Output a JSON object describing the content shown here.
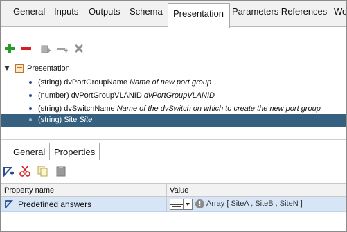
{
  "top_tabs": [
    {
      "label": "General"
    },
    {
      "label": "Inputs"
    },
    {
      "label": "Outputs"
    },
    {
      "label": "Schema"
    },
    {
      "label": "Presentation"
    },
    {
      "label": "Parameters References"
    },
    {
      "label": "Wo"
    }
  ],
  "active_top_tab": "Presentation",
  "toolbar": {
    "icons": [
      "add-icon",
      "remove-icon",
      "add-group-icon",
      "add-step-icon",
      "delete-icon"
    ],
    "colors": {
      "add": "#2a9a2a",
      "remove": "#d42020",
      "disabled": "#9a9a9a"
    }
  },
  "tree": {
    "root_label": "Presentation",
    "items": [
      {
        "type": "(string)",
        "name": "dvPortGroupName",
        "description": "Name of new port group"
      },
      {
        "type": "(number)",
        "name": "dvPortGroupVLANID",
        "description": "dvPortGroupVLANID"
      },
      {
        "type": "(string)",
        "name": "dvSwitchName",
        "description": "Name of the dvSwitch on which to create the new port group"
      },
      {
        "type": "(string)",
        "name": "Site",
        "description": "Site"
      }
    ],
    "selected_color": "#35607f"
  },
  "sub_tabs": [
    {
      "label": "General"
    },
    {
      "label": "Properties"
    }
  ],
  "active_sub_tab": "Properties",
  "properties_toolbar": {
    "icons": [
      "add-property-icon",
      "cut-icon",
      "copy-icon",
      "paste-icon"
    ]
  },
  "property_table": {
    "headers": [
      "Property name",
      "Value"
    ],
    "rows": [
      {
        "name": "Predefined answers",
        "value": "Array [ SiteA , SiteB , SiteN ]",
        "info_glyph": "!"
      }
    ],
    "row_highlight": "#d7e6f6"
  }
}
